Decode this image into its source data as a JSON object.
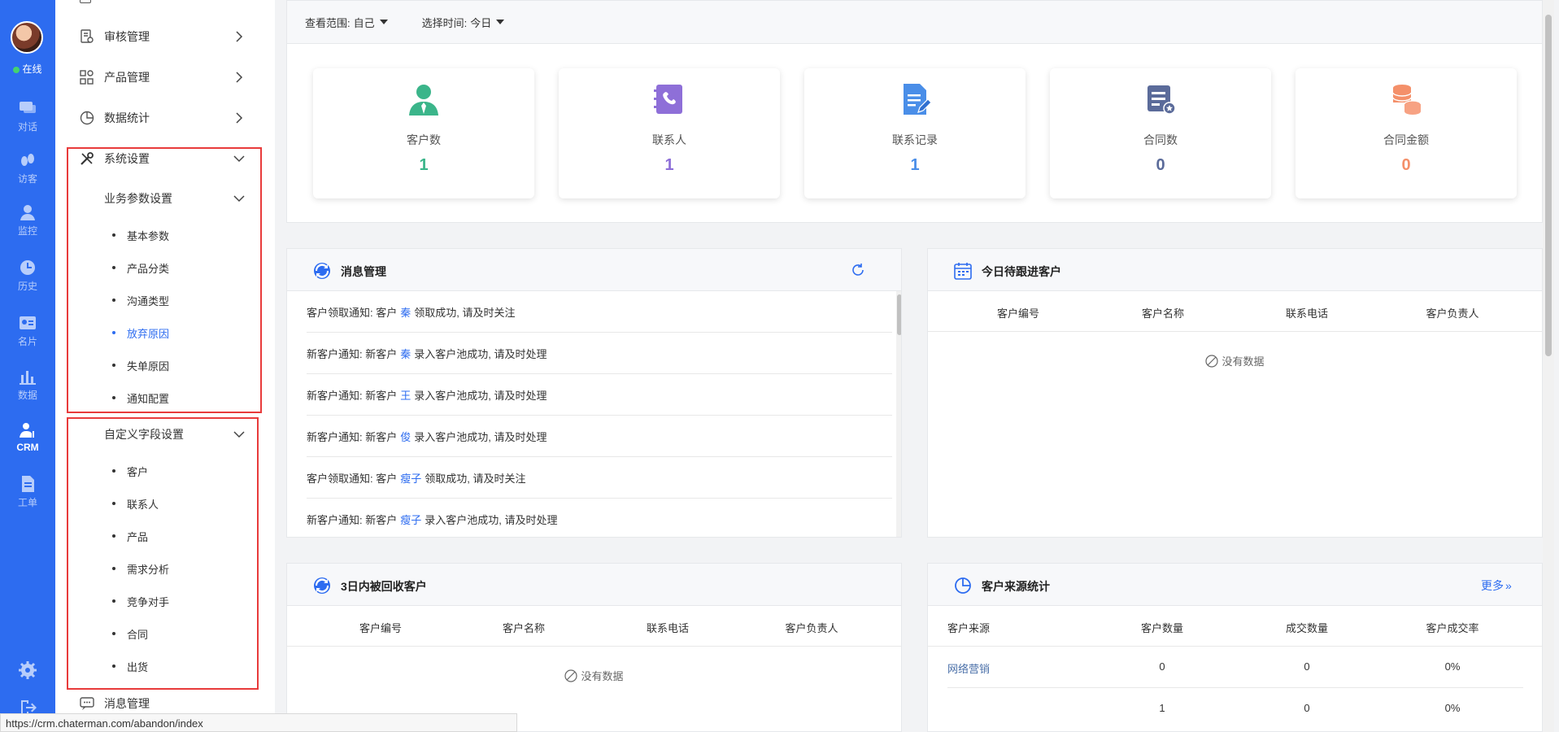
{
  "rail": {
    "status": "在线",
    "items": [
      {
        "label": "对话",
        "icon": "chat-icon"
      },
      {
        "label": "访客",
        "icon": "footprint-icon"
      },
      {
        "label": "监控",
        "icon": "monitor-icon"
      },
      {
        "label": "历史",
        "icon": "clock-icon"
      },
      {
        "label": "名片",
        "icon": "card-icon"
      },
      {
        "label": "数据",
        "icon": "bar-chart-icon"
      },
      {
        "label": "CRM",
        "icon": "crm-icon"
      },
      {
        "label": "工单",
        "icon": "ticket-icon"
      }
    ]
  },
  "sidebar": {
    "menu": [
      {
        "label": "审核管理"
      },
      {
        "label": "产品管理"
      },
      {
        "label": "数据统计"
      },
      {
        "label": "系统设置"
      }
    ],
    "business_params": {
      "title": "业务参数设置",
      "items": [
        "基本参数",
        "产品分类",
        "沟通类型",
        "放弃原因",
        "失单原因",
        "通知配置"
      ]
    },
    "custom_fields": {
      "title": "自定义字段设置",
      "items": [
        "客户",
        "联系人",
        "产品",
        "需求分析",
        "竞争对手",
        "合同",
        "出货"
      ]
    },
    "bottom_item": "消息管理"
  },
  "filters": {
    "scope_label": "查看范围:",
    "scope_value": "自己",
    "time_label": "选择时间:",
    "time_value": "今日"
  },
  "stats": [
    {
      "label": "客户数",
      "value": "1",
      "color": "#3bb58a"
    },
    {
      "label": "联系人",
      "value": "1",
      "color": "#8e6fd8"
    },
    {
      "label": "联系记录",
      "value": "1",
      "color": "#4a8ee8"
    },
    {
      "label": "合同数",
      "value": "0",
      "color": "#5b6b9a"
    },
    {
      "label": "合同金额",
      "value": "0",
      "color": "#f4906a"
    }
  ],
  "messages": {
    "title": "消息管理",
    "items": [
      {
        "pre": "客户领取通知: 客户",
        "name": "秦",
        "post": "领取成功, 请及时关注"
      },
      {
        "pre": "新客户通知: 新客户",
        "name": "秦",
        "post": "录入客户池成功, 请及时处理"
      },
      {
        "pre": "新客户通知: 新客户",
        "name": "王",
        "post": "录入客户池成功, 请及时处理"
      },
      {
        "pre": "新客户通知: 新客户",
        "name": "俊",
        "post": "录入客户池成功, 请及时处理"
      },
      {
        "pre": "客户领取通知: 客户",
        "name": "瘦子",
        "post": "领取成功, 请及时关注"
      },
      {
        "pre": "新客户通知: 新客户",
        "name": "瘦子",
        "post": "录入客户池成功, 请及时处理"
      }
    ]
  },
  "today_followup": {
    "title": "今日待跟进客户",
    "columns": [
      "客户编号",
      "客户名称",
      "联系电话",
      "客户负责人"
    ],
    "empty": "没有数据"
  },
  "recycled": {
    "title": "3日内被回收客户",
    "columns": [
      "客户编号",
      "客户名称",
      "联系电话",
      "客户负责人"
    ],
    "empty": "没有数据"
  },
  "source_stats": {
    "title": "客户来源统计",
    "more": "更多",
    "columns": [
      "客户来源",
      "客户数量",
      "成交数量",
      "客户成交率"
    ],
    "rows": [
      {
        "source": "网络营销",
        "count": "0",
        "deals": "0",
        "rate": "0%"
      },
      {
        "source": "",
        "count": "1",
        "deals": "0",
        "rate": "0%"
      }
    ]
  },
  "status_url": "https://crm.chaterman.com/abandon/index",
  "colors": {
    "primary": "#2d6cf0",
    "highlight_box": "#e83b3b"
  }
}
